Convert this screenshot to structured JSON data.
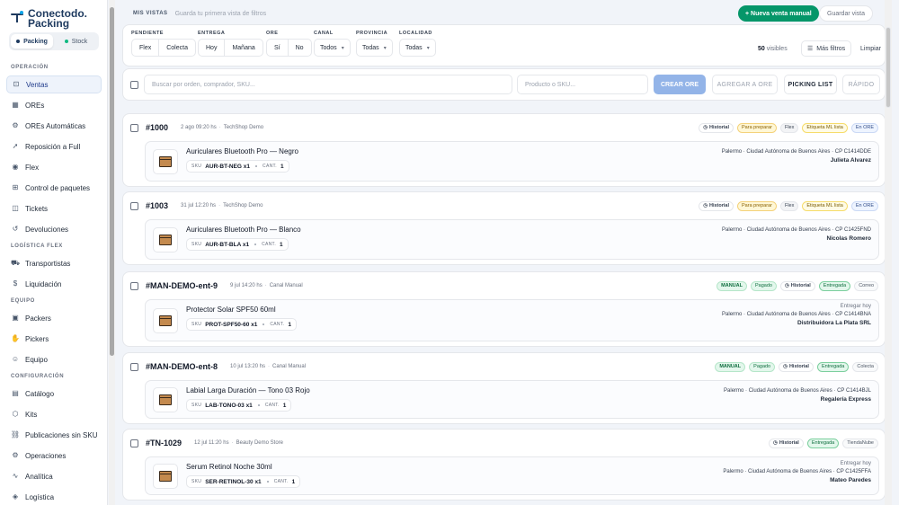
{
  "brand": {
    "name_line1": "Conectodo.",
    "name_line2": "Packing"
  },
  "mode": {
    "packing": "Packing",
    "stock": "Stock"
  },
  "sidebar": {
    "sections": [
      {
        "title": "OPERACIÓN",
        "items": [
          {
            "label": "Ventas",
            "icon": "cart-icon",
            "glyph": "⊡",
            "active": true
          },
          {
            "label": "OREs",
            "icon": "grid-icon",
            "glyph": "▦"
          },
          {
            "label": "OREs Automáticas",
            "icon": "gear-icon",
            "glyph": "⚙"
          },
          {
            "label": "Reposición a Full",
            "icon": "rocket-icon",
            "glyph": "➚"
          },
          {
            "label": "Flex",
            "icon": "pin-icon",
            "glyph": "◉"
          },
          {
            "label": "Control de paquetes",
            "icon": "scan-icon",
            "glyph": "⊞"
          },
          {
            "label": "Tickets",
            "icon": "ticket-icon",
            "glyph": "◫"
          },
          {
            "label": "Devoluciones",
            "icon": "return-icon",
            "glyph": "↺"
          }
        ]
      },
      {
        "title": "LOGÍSTICA FLEX",
        "items": [
          {
            "label": "Transportistas",
            "icon": "truck-icon",
            "glyph": "⛟"
          },
          {
            "label": "Liquidación",
            "icon": "dollar-icon",
            "glyph": "$"
          }
        ]
      },
      {
        "title": "EQUIPO",
        "items": [
          {
            "label": "Packers",
            "icon": "box-icon",
            "glyph": "▣"
          },
          {
            "label": "Pickers",
            "icon": "hand-icon",
            "glyph": "✋"
          },
          {
            "label": "Equipo",
            "icon": "users-icon",
            "glyph": "☺"
          }
        ]
      },
      {
        "title": "CONFIGURACIÓN",
        "items": [
          {
            "label": "Catálogo",
            "icon": "catalog-icon",
            "glyph": "▤"
          },
          {
            "label": "Kits",
            "icon": "kit-icon",
            "glyph": "⬡"
          },
          {
            "label": "Publicaciones sin SKU",
            "icon": "link-icon",
            "glyph": "⛓"
          },
          {
            "label": "Operaciones",
            "icon": "ops-icon",
            "glyph": "⚙"
          },
          {
            "label": "Analítica",
            "icon": "chart-icon",
            "glyph": "∿"
          },
          {
            "label": "Logística",
            "icon": "map-icon",
            "glyph": "◈"
          }
        ]
      }
    ]
  },
  "topbar": {
    "views_label": "MIS VISTAS",
    "views_hint": "Guarda tu primera vista de filtros",
    "new_sale": "+ Nueva venta manual",
    "save_view": "Guardar vista"
  },
  "filters": {
    "pendiente": {
      "label": "PENDIENTE",
      "options": [
        "Flex",
        "Colecta"
      ]
    },
    "entrega": {
      "label": "ENTREGA",
      "options": [
        "Hoy",
        "Mañana"
      ]
    },
    "ore": {
      "label": "ORE",
      "options": [
        "Sí",
        "No"
      ]
    },
    "canal": {
      "label": "CANAL",
      "value": "Todos"
    },
    "provincia": {
      "label": "PROVINCIA",
      "value": "Todas"
    },
    "localidad": {
      "label": "LOCALIDAD",
      "value": "Todas"
    },
    "visibles_count": "50",
    "visibles_label": "visibles",
    "more": "Más filtros",
    "clear": "Limpiar"
  },
  "search": {
    "placeholder": "Buscar por orden, comprador, SKU...",
    "product_placeholder": "Producto o SKU...",
    "crear_ore": "CREAR ORE",
    "agregar_ore": "AGREGAR A ORE",
    "picking_list": "PICKING LIST",
    "rapido": "RÁPIDO"
  },
  "orders": [
    {
      "number": "#1000",
      "date": "2 ago 09:20 hs",
      "shop": "TechShop Demo",
      "badges": [
        {
          "text": "Historial",
          "kind": "hist"
        },
        {
          "text": "Para preparar",
          "kind": "prep"
        },
        {
          "text": "Flex",
          "kind": "flex"
        },
        {
          "text": "Etiqueta ML lista",
          "kind": "etq"
        },
        {
          "text": "En ORE",
          "kind": "ore"
        }
      ],
      "item": {
        "title": "Auriculares Bluetooth Pro — Negro",
        "sku": "AUR-BT-NEG x1",
        "qty": "1",
        "delivered": "",
        "address": "Palermo · Ciudad Autónoma de Buenos Aires · CP C1414DDE",
        "recipient": "Julieta Alvarez"
      }
    },
    {
      "number": "#1003",
      "date": "31 jul 12:20 hs",
      "shop": "TechShop Demo",
      "badges": [
        {
          "text": "Historial",
          "kind": "hist"
        },
        {
          "text": "Para preparar",
          "kind": "prep"
        },
        {
          "text": "Flex",
          "kind": "flex"
        },
        {
          "text": "Etiqueta ML lista",
          "kind": "etq"
        },
        {
          "text": "En ORE",
          "kind": "ore"
        }
      ],
      "item": {
        "title": "Auriculares Bluetooth Pro — Blanco",
        "sku": "AUR-BT-BLA x1",
        "qty": "1",
        "delivered": "",
        "address": "Palermo · Ciudad Autónoma de Buenos Aires · CP C1425FND",
        "recipient": "Nicolas Romero"
      }
    },
    {
      "number": "#MAN-DEMO-ent-9",
      "date": "9 jul 14:20 hs",
      "shop": "Canal Manual",
      "badges": [
        {
          "text": "MANUAL",
          "kind": "manual"
        },
        {
          "text": "Pagado",
          "kind": "pagado"
        },
        {
          "text": "Historial",
          "kind": "hist"
        },
        {
          "text": "Entregada",
          "kind": "entregada"
        },
        {
          "text": "Correo",
          "kind": "plain"
        }
      ],
      "item": {
        "title": "Protector Solar SPF50 60ml",
        "sku": "PROT-SPF50-60 x1",
        "qty": "1",
        "delivered": "Entregar hoy",
        "address": "Palermo · Ciudad Autónoma de Buenos Aires · CP C1414BNA",
        "recipient": "Distribuidora La Plata SRL"
      }
    },
    {
      "number": "#MAN-DEMO-ent-8",
      "date": "10 jul 13:20 hs",
      "shop": "Canal Manual",
      "badges": [
        {
          "text": "MANUAL",
          "kind": "manual"
        },
        {
          "text": "Pagado",
          "kind": "pagado"
        },
        {
          "text": "Historial",
          "kind": "hist"
        },
        {
          "text": "Entregada",
          "kind": "entregada"
        },
        {
          "text": "Colecta",
          "kind": "plain"
        }
      ],
      "item": {
        "title": "Labial Larga Duración — Tono 03 Rojo",
        "sku": "LAB-TONO-03 x1",
        "qty": "1",
        "delivered": "",
        "address": "Palermo · Ciudad Autónoma de Buenos Aires · CP C1414BJL",
        "recipient": "Regalería Express"
      }
    },
    {
      "number": "#TN-1029",
      "date": "12 jul 11:20 hs",
      "shop": "Beauty Demo Store",
      "badges": [
        {
          "text": "Historial",
          "kind": "hist"
        },
        {
          "text": "Entregada",
          "kind": "entregada"
        },
        {
          "text": "TiendaNube",
          "kind": "plain"
        }
      ],
      "item": {
        "title": "Serum Retinol Noche 30ml",
        "sku": "SER-RETINOL-30 x1",
        "qty": "1",
        "delivered": "Entregar hoy",
        "address": "Palermo · Ciudad Autónoma de Buenos Aires · CP C1425FFA",
        "recipient": "Mateo Paredes"
      }
    }
  ],
  "labels": {
    "sku": "SKU",
    "cant": "CANT."
  }
}
